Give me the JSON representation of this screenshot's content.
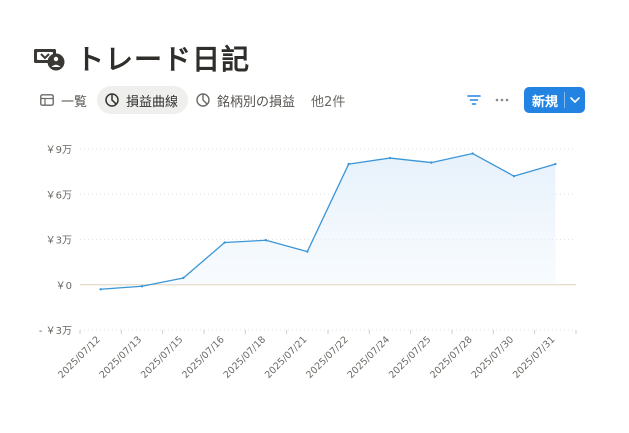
{
  "page": {
    "title": "トレード日記",
    "icon": "money-bag-icon"
  },
  "views": {
    "tabs": [
      {
        "label": "一覧",
        "icon": "table-icon",
        "active": false
      },
      {
        "label": "損益曲線",
        "icon": "chart-icon",
        "active": true
      },
      {
        "label": "銘柄別の損益",
        "icon": "chart-icon",
        "active": false
      }
    ],
    "more_label": "他2件"
  },
  "toolbar": {
    "filter_icon": "filter-icon",
    "more_icon": "more-icon",
    "new_label": "新規",
    "new_caret_icon": "chevron-down-icon"
  },
  "chart_data": {
    "type": "area",
    "categories": [
      "2025/07/12",
      "2025/07/13",
      "2025/07/15",
      "2025/07/16",
      "2025/07/18",
      "2025/07/21",
      "2025/07/22",
      "2025/07/24",
      "2025/07/25",
      "2025/07/28",
      "2025/07/30",
      "2025/07/31"
    ],
    "values": [
      -0.3,
      -0.1,
      0.45,
      2.8,
      2.95,
      2.2,
      8.0,
      8.4,
      8.1,
      8.7,
      7.2,
      8.0
    ],
    "y_ticks": [
      {
        "value": 9,
        "label": "￥9万"
      },
      {
        "value": 6,
        "label": "￥6万"
      },
      {
        "value": 3,
        "label": "￥3万"
      },
      {
        "value": 0,
        "label": "￥0"
      },
      {
        "value": -3,
        "label": "- ￥3万"
      }
    ],
    "ylim": [
      -3,
      9
    ],
    "grid": true,
    "line_color": "#3b96d8",
    "fill_color": "#e6f1fb",
    "grid_color": "#e3e3e1",
    "zero_line_color": "#e2cfb8"
  }
}
